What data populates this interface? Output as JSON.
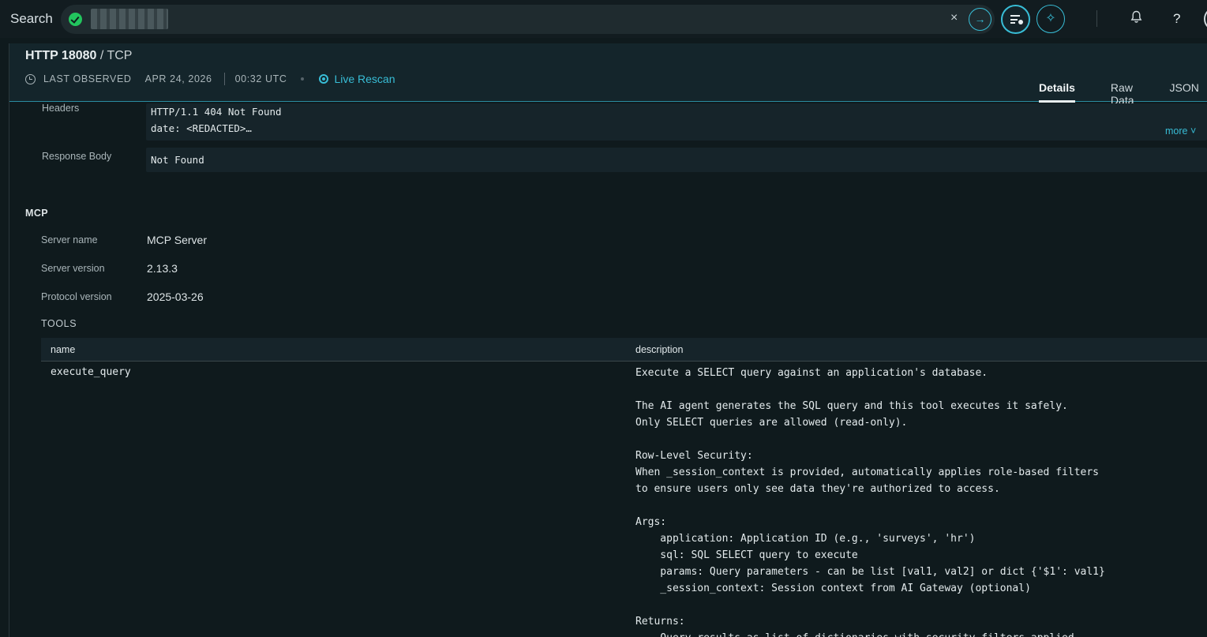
{
  "search": {
    "label": "Search",
    "query": "●●●●●●●●",
    "clear": "×",
    "go": "→"
  },
  "topbar": {
    "ai_icon": "✧",
    "bell_icon": "🔔",
    "help": "?"
  },
  "header": {
    "title_main": "HTTP 18080",
    "title_sep": " / ",
    "title_sub": "TCP",
    "last_observed_label": "LAST OBSERVED",
    "date": "APR 24, 2026",
    "time": "00:32 UTC",
    "rescan": "Live Rescan",
    "tabs": [
      {
        "label": "Details",
        "active": true
      },
      {
        "label": "Raw Data",
        "active": false
      },
      {
        "label": "JSON",
        "active": false
      }
    ]
  },
  "http": {
    "headers_label": "Headers",
    "headers_value": "HTTP/1.1 404 Not Found\ndate: <REDACTED>…",
    "more": "more ˅",
    "body_label": "Response Body",
    "body_value": "Not Found"
  },
  "mcp": {
    "section": "MCP",
    "fields": [
      {
        "label": "Server name",
        "value": "MCP Server"
      },
      {
        "label": "Server version",
        "value": "2.13.3"
      },
      {
        "label": "Protocol version",
        "value": "2025-03-26"
      }
    ],
    "tools_label": "TOOLS",
    "columns": [
      "name",
      "description"
    ],
    "tools": [
      {
        "name": "execute_query",
        "description": "Execute a SELECT query against an application's database.\n\nThe AI agent generates the SQL query and this tool executes it safely.\nOnly SELECT queries are allowed (read-only).\n\nRow-Level Security:\nWhen _session_context is provided, automatically applies role-based filters\nto ensure users only see data they're authorized to access.\n\nArgs:\n    application: Application ID (e.g., 'surveys', 'hr')\n    sql: SQL SELECT query to execute\n    params: Query parameters - can be list [val1, val2] or dict {'$1': val1}\n    _session_context: Session context from AI Gateway (optional)\n\nReturns:\n    Query results as list of dictionaries with security filters applied"
      }
    ]
  },
  "colors": {
    "accent": "#38bdd6",
    "success": "#22c55e",
    "background": "#0f1a1d",
    "panel": "#16242a"
  }
}
